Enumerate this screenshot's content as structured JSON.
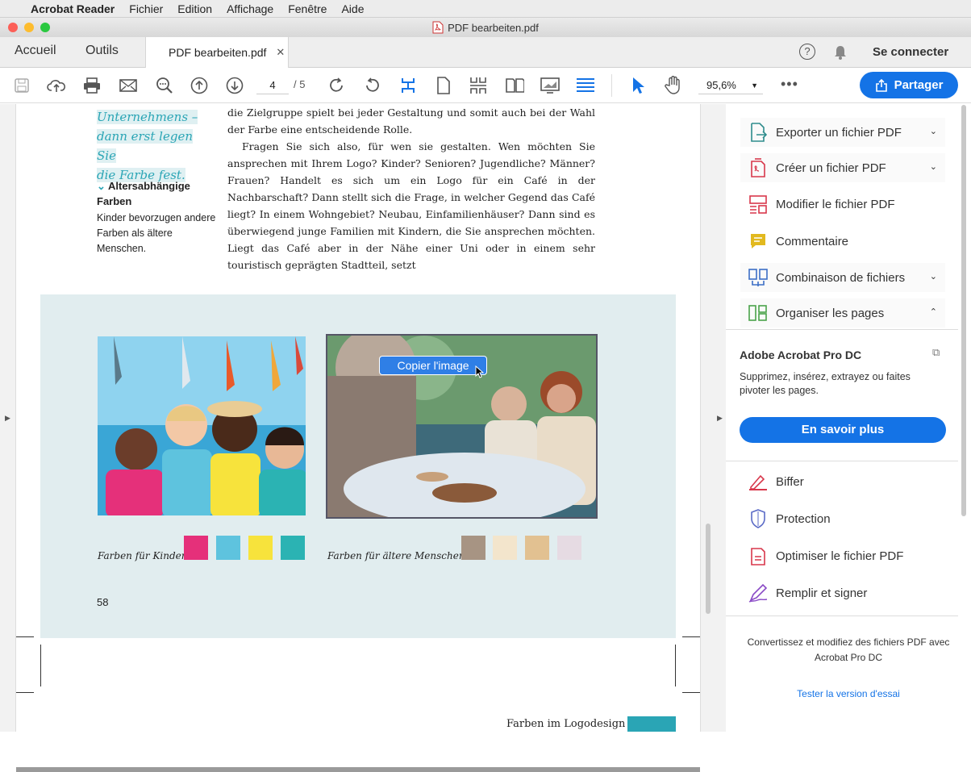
{
  "menubar": {
    "app": "Acrobat Reader",
    "items": [
      "Fichier",
      "Edition",
      "Affichage",
      "Fenêtre",
      "Aide"
    ]
  },
  "window": {
    "title": "PDF bearbeiten.pdf"
  },
  "tabs": {
    "home": "Accueil",
    "tools": "Outils",
    "document": "PDF bearbeiten.pdf",
    "signin": "Se connecter"
  },
  "toolbar": {
    "page_current": "4",
    "page_total": "/ 5",
    "zoom": "95,6%",
    "share": "Partager"
  },
  "document": {
    "quote": [
      "Unternehmens –",
      "dann erst legen Sie",
      "die Farbe fest."
    ],
    "side_heading": "Altersabhängige Farben",
    "side_body": "Kinder bevorzugen andere Farben als ältere Menschen.",
    "body_p1": "die Zielgruppe spielt bei jeder Gestaltung und somit auch bei der Wahl der Farbe eine entscheidende Rolle.",
    "body_p2": "Fragen Sie sich also, für wen sie gestalten. Wen möchten Sie ansprechen mit Ihrem Logo? Kinder? Senioren? Jugendliche? Männer? Frauen? Handelt es sich um ein Logo für ein Café in der Nachbarschaft? Dann stellt sich die Frage, in welcher Gegend das Café liegt? In einem Wohngebiet? Neubau, Einfamilienhäuser? Dann sind es überwiegend junge Familien mit Kindern, die Sie ansprechen möchten. Liegt das Café aber in der Nähe einer Uni oder in einem sehr touristisch geprägten Stadtteil, setzt",
    "context_menu": "Copier l'image",
    "caption_kids": "Farben für Kinder",
    "caption_seniors": "Farben für ältere Menschen",
    "swatches_kids": [
      "#e5307a",
      "#5ec3de",
      "#f7e33c",
      "#2bb3b3"
    ],
    "swatches_seniors": [
      "#a79483",
      "#f3e5cc",
      "#e2c191",
      "#e6dbe3"
    ],
    "page_number": "58",
    "footer": "Farben im Logodesign"
  },
  "right_panel": {
    "tools": [
      {
        "label": "Exporter un fichier PDF",
        "chevron": "⌄"
      },
      {
        "label": "Créer un fichier PDF",
        "chevron": "⌄"
      },
      {
        "label": "Modifier le fichier PDF",
        "chevron": ""
      },
      {
        "label": "Commentaire",
        "chevron": ""
      },
      {
        "label": "Combinaison de fichiers",
        "chevron": "⌄"
      },
      {
        "label": "Organiser les pages",
        "chevron": "⌃"
      }
    ],
    "promo_title": "Adobe Acrobat Pro DC",
    "promo_desc": "Supprimez, insérez, extrayez ou faites pivoter les pages.",
    "learn_more": "En savoir plus",
    "more_tools": [
      "Biffer",
      "Protection",
      "Optimiser le fichier PDF",
      "Remplir et signer"
    ],
    "bottom_note": "Convertissez et modifiez des fichiers PDF avec Acrobat Pro DC",
    "trial": "Tester la version d'essai"
  },
  "colors": {
    "accent": "#1473e6",
    "teal": "#2aa5b5"
  }
}
